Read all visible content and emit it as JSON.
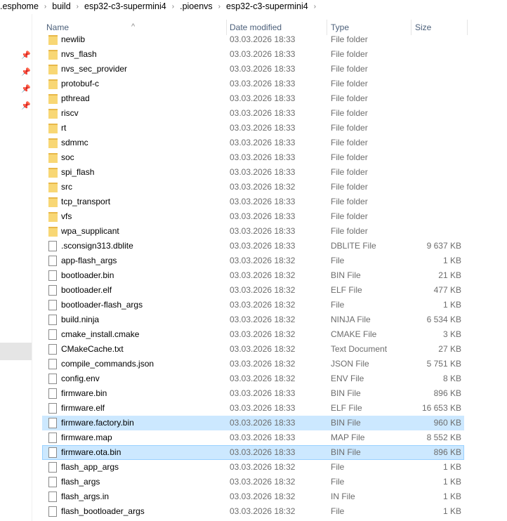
{
  "breadcrumb": [
    ".esphome",
    "build",
    "esp32-c3-supermini4",
    ".pioenvs",
    "esp32-c3-supermini4"
  ],
  "columns": {
    "name": "Name",
    "date": "Date modified",
    "type": "Type",
    "size": "Size"
  },
  "rows": [
    {
      "name": "newlib",
      "date": "03.03.2026 18:33",
      "type": "File folder",
      "size": "",
      "kind": "folder"
    },
    {
      "name": "nvs_flash",
      "date": "03.03.2026 18:33",
      "type": "File folder",
      "size": "",
      "kind": "folder"
    },
    {
      "name": "nvs_sec_provider",
      "date": "03.03.2026 18:33",
      "type": "File folder",
      "size": "",
      "kind": "folder"
    },
    {
      "name": "protobuf-c",
      "date": "03.03.2026 18:33",
      "type": "File folder",
      "size": "",
      "kind": "folder"
    },
    {
      "name": "pthread",
      "date": "03.03.2026 18:33",
      "type": "File folder",
      "size": "",
      "kind": "folder"
    },
    {
      "name": "riscv",
      "date": "03.03.2026 18:33",
      "type": "File folder",
      "size": "",
      "kind": "folder"
    },
    {
      "name": "rt",
      "date": "03.03.2026 18:33",
      "type": "File folder",
      "size": "",
      "kind": "folder"
    },
    {
      "name": "sdmmc",
      "date": "03.03.2026 18:33",
      "type": "File folder",
      "size": "",
      "kind": "folder"
    },
    {
      "name": "soc",
      "date": "03.03.2026 18:33",
      "type": "File folder",
      "size": "",
      "kind": "folder"
    },
    {
      "name": "spi_flash",
      "date": "03.03.2026 18:33",
      "type": "File folder",
      "size": "",
      "kind": "folder"
    },
    {
      "name": "src",
      "date": "03.03.2026 18:32",
      "type": "File folder",
      "size": "",
      "kind": "folder"
    },
    {
      "name": "tcp_transport",
      "date": "03.03.2026 18:33",
      "type": "File folder",
      "size": "",
      "kind": "folder"
    },
    {
      "name": "vfs",
      "date": "03.03.2026 18:33",
      "type": "File folder",
      "size": "",
      "kind": "folder"
    },
    {
      "name": "wpa_supplicant",
      "date": "03.03.2026 18:33",
      "type": "File folder",
      "size": "",
      "kind": "folder"
    },
    {
      "name": ".sconsign313.dblite",
      "date": "03.03.2026 18:33",
      "type": "DBLITE File",
      "size": "9 637 KB",
      "kind": "file"
    },
    {
      "name": "app-flash_args",
      "date": "03.03.2026 18:32",
      "type": "File",
      "size": "1 KB",
      "kind": "file"
    },
    {
      "name": "bootloader.bin",
      "date": "03.03.2026 18:32",
      "type": "BIN File",
      "size": "21 KB",
      "kind": "file"
    },
    {
      "name": "bootloader.elf",
      "date": "03.03.2026 18:32",
      "type": "ELF File",
      "size": "477 KB",
      "kind": "file"
    },
    {
      "name": "bootloader-flash_args",
      "date": "03.03.2026 18:32",
      "type": "File",
      "size": "1 KB",
      "kind": "file"
    },
    {
      "name": "build.ninja",
      "date": "03.03.2026 18:32",
      "type": "NINJA File",
      "size": "6 534 KB",
      "kind": "file"
    },
    {
      "name": "cmake_install.cmake",
      "date": "03.03.2026 18:32",
      "type": "CMAKE File",
      "size": "3 KB",
      "kind": "file"
    },
    {
      "name": "CMakeCache.txt",
      "date": "03.03.2026 18:32",
      "type": "Text Document",
      "size": "27 KB",
      "kind": "file"
    },
    {
      "name": "compile_commands.json",
      "date": "03.03.2026 18:32",
      "type": "JSON File",
      "size": "5 751 KB",
      "kind": "file"
    },
    {
      "name": "config.env",
      "date": "03.03.2026 18:32",
      "type": "ENV File",
      "size": "8 KB",
      "kind": "file"
    },
    {
      "name": "firmware.bin",
      "date": "03.03.2026 18:33",
      "type": "BIN File",
      "size": "896 KB",
      "kind": "file"
    },
    {
      "name": "firmware.elf",
      "date": "03.03.2026 18:33",
      "type": "ELF File",
      "size": "16 653 KB",
      "kind": "file"
    },
    {
      "name": "firmware.factory.bin",
      "date": "03.03.2026 18:33",
      "type": "BIN File",
      "size": "960 KB",
      "kind": "file",
      "state": "sel"
    },
    {
      "name": "firmware.map",
      "date": "03.03.2026 18:33",
      "type": "MAP File",
      "size": "8 552 KB",
      "kind": "file"
    },
    {
      "name": "firmware.ota.bin",
      "date": "03.03.2026 18:33",
      "type": "BIN File",
      "size": "896 KB",
      "kind": "file",
      "state": "sel2"
    },
    {
      "name": "flash_app_args",
      "date": "03.03.2026 18:32",
      "type": "File",
      "size": "1 KB",
      "kind": "file"
    },
    {
      "name": "flash_args",
      "date": "03.03.2026 18:32",
      "type": "File",
      "size": "1 KB",
      "kind": "file"
    },
    {
      "name": "flash_args.in",
      "date": "03.03.2026 18:32",
      "type": "IN File",
      "size": "1 KB",
      "kind": "file"
    },
    {
      "name": "flash_bootloader_args",
      "date": "03.03.2026 18:32",
      "type": "File",
      "size": "1 KB",
      "kind": "file"
    }
  ]
}
